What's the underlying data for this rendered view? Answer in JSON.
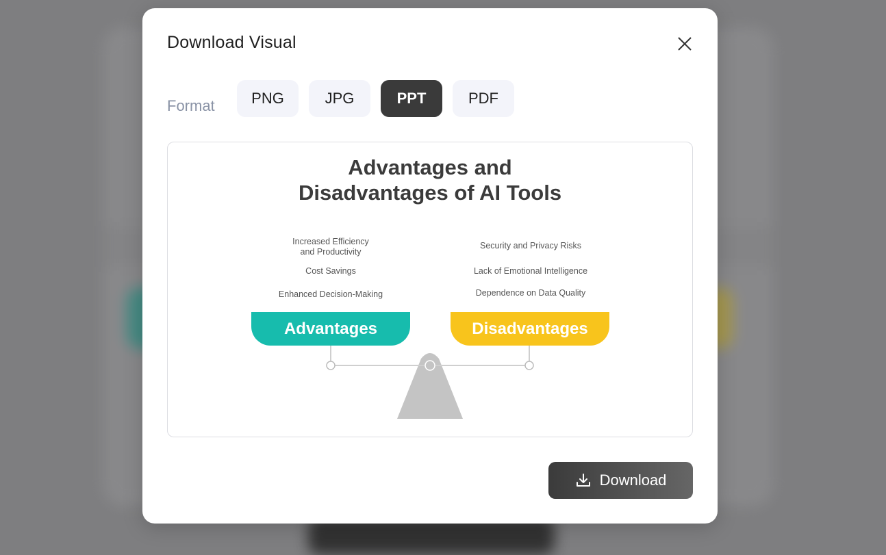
{
  "dialog": {
    "title": "Download Visual",
    "format_label": "Format",
    "formats": [
      "PNG",
      "JPG",
      "PPT",
      "PDF"
    ],
    "selected_format": "PPT",
    "download_label": "Download"
  },
  "preview": {
    "title_line1": "Advantages and",
    "title_line2": "Disadvantages of AI Tools",
    "advantages_label": "Advantages",
    "disadvantages_label": "Disadvantages",
    "advantages": [
      "Increased Efficiency\nand Productivity",
      "Cost Savings",
      "Enhanced Decision-Making"
    ],
    "disadvantages": [
      "Security and Privacy Risks",
      "Lack of Emotional Intelligence",
      "Dependence on Data Quality"
    ],
    "colors": {
      "advantages": "#17bcad",
      "disadvantages": "#f8c41c"
    }
  },
  "icons": {
    "close": "close-icon",
    "download": "download-icon"
  }
}
